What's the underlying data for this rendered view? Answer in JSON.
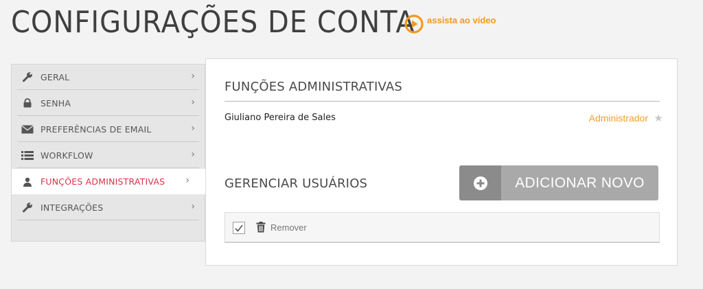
{
  "page": {
    "title": "CONFIGURAÇÕES DE CONTA",
    "video_link": "assista ao vídeo"
  },
  "sidebar": {
    "items": [
      {
        "label": "GERAL",
        "icon": "wrench-icon",
        "chevron": "›"
      },
      {
        "label": "SENHA",
        "icon": "lock-icon",
        "chevron": "›"
      },
      {
        "label": "PREFERÊNCIAS DE EMAIL",
        "icon": "envelope-icon",
        "chevron": "›"
      },
      {
        "label": "WORKFLOW",
        "icon": "list-icon",
        "chevron": "›"
      },
      {
        "label": "FUNÇÕES ADMINISTRATIVAS",
        "icon": "user-icon",
        "chevron": "›",
        "active": true
      },
      {
        "label": "INTEGRAÇÕES",
        "icon": "wrench-icon",
        "chevron": "›"
      }
    ]
  },
  "panel": {
    "heading": "FUNÇÕES ADMINISTRATIVAS",
    "admin": {
      "name": "Giuliano Pereira de Sales",
      "role": "Administrador"
    },
    "users_heading": "GERENCIAR USUÁRIOS",
    "add_button": "ADICIONAR NOVO",
    "toolbar": {
      "remove_label": "Remover",
      "checkbox_checked": true
    }
  },
  "colors": {
    "accent_orange": "#f39a1e",
    "active_red": "#d9304a",
    "button_gray": "#a9a9a9"
  }
}
